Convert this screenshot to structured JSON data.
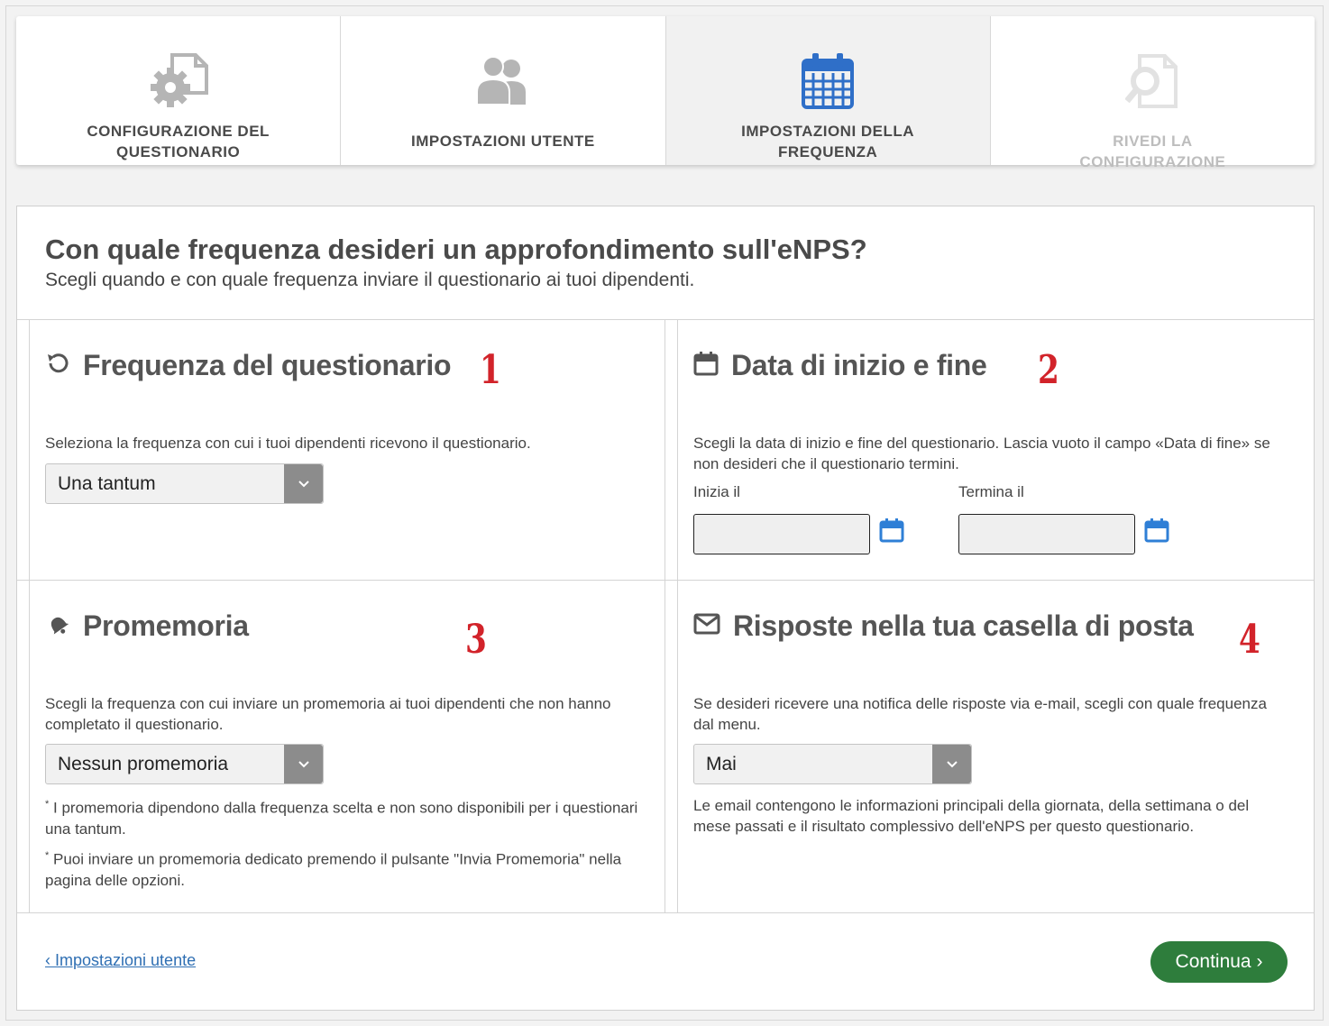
{
  "steps": [
    {
      "label": "CONFIGURAZIONE DEL QUESTIONARIO",
      "icon": "gear-document-icon",
      "state": "done"
    },
    {
      "label": "IMPOSTAZIONI UTENTE",
      "icon": "users-icon",
      "state": "done"
    },
    {
      "label": "IMPOSTAZIONI DELLA FREQUENZA",
      "icon": "calendar-icon",
      "state": "active"
    },
    {
      "label": "RIVEDI LA CONFIGURAZIONE",
      "icon": "search-document-icon",
      "state": "disabled"
    }
  ],
  "header": {
    "title": "Con quale frequenza desideri un approfondimento sull'eNPS?",
    "subtitle": "Scegli quando e con quale frequenza inviare il questionario ai tuoi dipendenti."
  },
  "frequency": {
    "number": "1",
    "title": "Frequenza del questionario",
    "description": "Seleziona la frequenza con cui i tuoi dipendenti ricevono il questionario.",
    "selected": "Una tantum"
  },
  "dates": {
    "number": "2",
    "title": "Data di inizio e fine",
    "description": "Scegli la data di inizio e fine del questionario. Lascia vuoto il campo «Data di fine» se non desideri che il questionario termini.",
    "start_label": "Inizia il",
    "end_label": "Termina il",
    "start_value": "",
    "end_value": ""
  },
  "reminders": {
    "number": "3",
    "title": "Promemoria",
    "description": "Scegli la frequenza con cui inviare un promemoria ai tuoi dipendenti che non hanno completato il questionario.",
    "selected": "Nessun promemoria",
    "note1": "I promemoria dipendono dalla frequenza scelta e non sono disponibili per i questionari una tantum.",
    "note2": "Puoi inviare un promemoria dedicato premendo il pulsante \"Invia Promemoria\" nella pagina delle opzioni."
  },
  "inbox": {
    "number": "4",
    "title": "Risposte nella tua casella di posta",
    "description": "Se desideri ricevere una notifica delle risposte via e-mail, scegli con quale frequenza dal menu.",
    "selected": "Mai",
    "note": "Le email contengono le informazioni principali della giornata, della settimana o del mese passati e il risultato complessivo dell'eNPS per questo questionario."
  },
  "footer": {
    "back_label": "‹ Impostazioni utente",
    "continue_label": "Continua ›"
  },
  "colors": {
    "accent": "#2f6fb3",
    "primary_button": "#2e7d3c",
    "annotation": "#d2232a"
  }
}
